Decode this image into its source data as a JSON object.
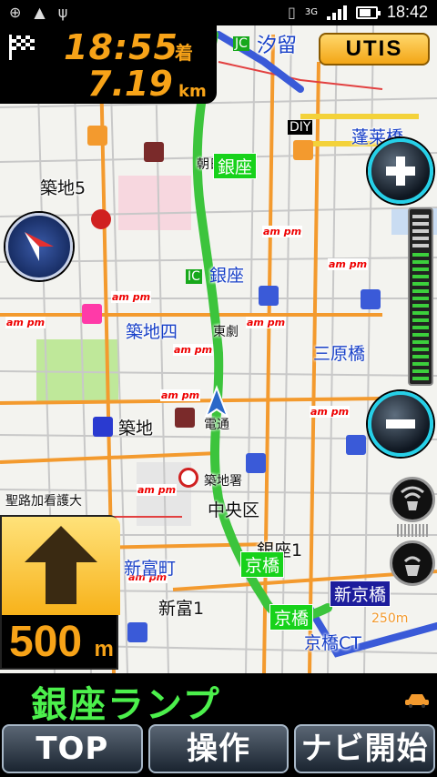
{
  "status_bar": {
    "clock": "18:42",
    "network": "3G"
  },
  "eta": {
    "arrival_time": "18:55",
    "arrival_suffix": "着",
    "distance": "7.19",
    "distance_unit": "km"
  },
  "utis_button": {
    "label": "UTIS"
  },
  "map": {
    "labels": {
      "shiodome": "汐留",
      "shintomi_bridge": "蓬莱橋",
      "tsukiji5": "築地5",
      "asahi": "朝日",
      "ginza_box": "銀座",
      "ginza_ic": "銀座",
      "tsukiji4": "築地四",
      "higashi": "東劇",
      "sanbara": "三原橋",
      "tsukiji_stn": "築地",
      "dentsu": "電通",
      "tsukijisho": "築地署",
      "seiroka": "聖路加看護大",
      "chuoku": "中央区",
      "ginza1": "銀座1",
      "shintomicho": "新富町",
      "kyobashi_box": "京橋",
      "shintomi1": "新富1",
      "kyobashi_box2": "京橋",
      "shinkyobashi": "新京橋",
      "kyobashi_ct": "京橋CT",
      "dist_250": "250m",
      "diy": "DIY",
      "jc": "JC",
      "ic": "IC"
    }
  },
  "next_turn": {
    "distance": "500",
    "unit": "m"
  },
  "road_name": "銀座ランプ",
  "buttons": {
    "top": "TOP",
    "operation": "操作",
    "navi_start": "ナビ開始"
  },
  "colors": {
    "eta_orange": "#f7a318",
    "route_green": "#3cc43c",
    "road_orange": "#f39a2e",
    "expressway_blue": "#3a5ad8",
    "road_name_green": "#4cf04c"
  }
}
